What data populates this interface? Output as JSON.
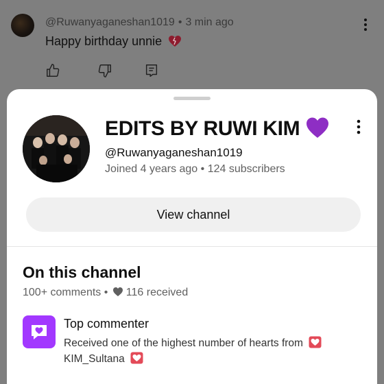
{
  "comment": {
    "author_handle": "@Ruwanyaganeshan1019",
    "separator": "•",
    "time_ago": "3 min ago",
    "text": "Happy birthday unnie",
    "emoji_name": "mending-heart",
    "more_icon": "vertical-dots-icon",
    "actions": [
      {
        "name": "like-button",
        "icon": "thumbs-up-icon"
      },
      {
        "name": "dislike-button",
        "icon": "thumbs-down-icon"
      },
      {
        "name": "reply-button",
        "icon": "reply-icon"
      }
    ]
  },
  "channel": {
    "name": "EDITS BY RUWI KIM",
    "name_emoji": "purple-heart",
    "handle": "@Ruwanyaganeshan1019",
    "joined": "Joined 4 years ago",
    "separator": "•",
    "subscribers": "124 subscribers",
    "view_button_label": "View channel"
  },
  "on_this_channel": {
    "title": "On this channel",
    "comments": "100+ comments",
    "separator": "•",
    "received": "116 received",
    "badge": {
      "title": "Top commenter",
      "description": "Received one of the highest number of hearts from",
      "from_user": "KIM_Sultana"
    }
  },
  "colors": {
    "badge": "#a238ff",
    "heart_box": "#e34a58",
    "purple_heart": "#8e2ec4",
    "dim_overlay": "#7f7f7f"
  }
}
